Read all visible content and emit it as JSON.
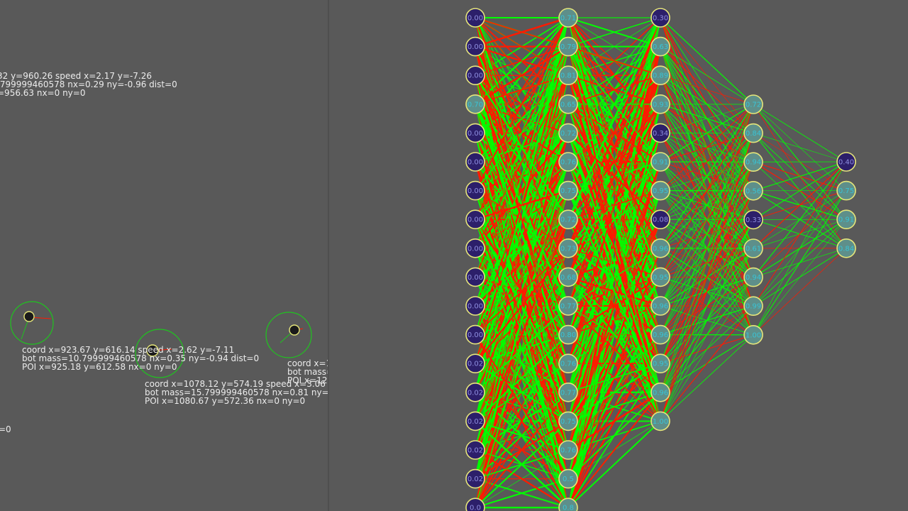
{
  "colors": {
    "background": "#595959",
    "positive_weight": "#00ff00",
    "negative_weight": "#ff1a00",
    "neuron_ring": "#e6e67a",
    "neuron_dark_fill": "#2c1f6a",
    "neuron_light_fill": "#5e8f8a",
    "neuron_label_dark": "#8f8fe0",
    "neuron_label_light": "#39c4d6",
    "sensor_circle": "#1fc41f",
    "text": "#ececec"
  },
  "simulation": {
    "top_info": [
      "32 y=960.26 speed x=2.17 y=-7.26",
      ".799999460578 nx=0.29 ny=-0.96 dist=0",
      "=956.63 nx=0 ny=0"
    ],
    "bots": [
      {
        "info": [
          "coord x=923.67 y=616.14 speed x=2.62 y=-7.11",
          "bot mass=10.799999460578 nx=0.35 ny=-0.94 dist=0",
          "POI x=925.18 y=612.58 nx=0 ny=0"
        ]
      },
      {
        "info": [
          "coord x=1078.12 y=574.19 speed x=3.06 y=-",
          "bot mass=15.799999460578 nx=0.81 ny=-",
          "POI x=1080.67 y=572.36 nx=0 ny=0"
        ]
      },
      {
        "info": [
          "coord x=1",
          "bot mass=",
          "POI x=125"
        ]
      }
    ],
    "edge_text": "=0"
  },
  "network": {
    "layers": [
      {
        "name": "input",
        "values": [
          "0.00",
          "0.00",
          "0.00",
          "0.70",
          "0.00",
          "0.00",
          "0.00",
          "0.00",
          "0.00",
          "0.00",
          "0.00",
          "0.00",
          "0.02",
          "0.02",
          "0.02",
          "0.02",
          "0.02",
          "0.0"
        ]
      },
      {
        "name": "hidden1",
        "values": [
          "0.71",
          "0.79",
          "0.81",
          "0.65",
          "0.72",
          "0.76",
          "0.75",
          "0.72",
          "0.73",
          "0.68",
          "0.77",
          "0.80",
          "0.76",
          "0.77",
          "0.75",
          "0.76",
          "0.5",
          "0.8"
        ]
      },
      {
        "name": "hidden2",
        "values": [
          "0.30",
          "0.63",
          "0.89",
          "0.93",
          "0.34",
          "0.91",
          "0.95",
          "0.08",
          "0.96",
          "0.95",
          "0.96",
          "0.96",
          "0.95",
          "0.96",
          "1.00"
        ]
      },
      {
        "name": "hidden3",
        "values": [
          "0.72",
          "0.84",
          "0.94",
          "0.56",
          "0.33",
          "0.61",
          "0.94",
          "0.99",
          "1.00"
        ]
      },
      {
        "name": "output",
        "values": [
          "0.40",
          "0.75",
          "0.91",
          "0.84"
        ]
      }
    ]
  }
}
